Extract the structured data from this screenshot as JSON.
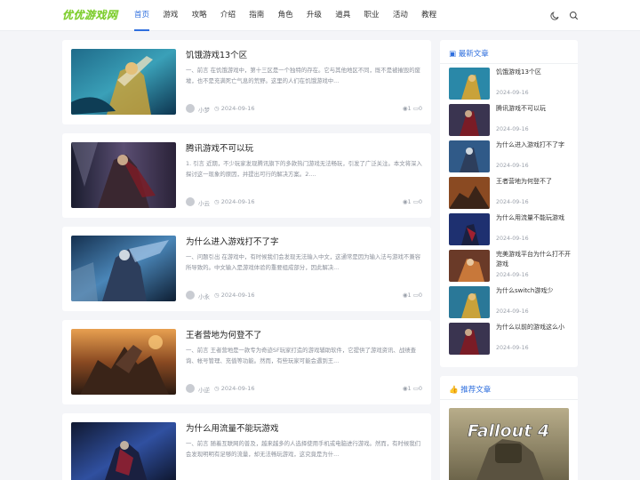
{
  "site": {
    "logo": "优优游戏网"
  },
  "nav": [
    "首页",
    "游戏",
    "攻略",
    "介绍",
    "指南",
    "角色",
    "升级",
    "道具",
    "职业",
    "活动",
    "教程"
  ],
  "header_icons": [
    "moon-icon",
    "search-icon"
  ],
  "posts": [
    {
      "title": "饥饿游戏13个区",
      "excerpt": "一、前言 在饥饿游戏中，第十三区是一个独特的存在。它与其他地区不同，既不是被摧毁的废墟，也不是充满死亡气息的荒野。这里的人们在饥饿游戏中...",
      "author": "小梦",
      "date": "2024-09-16",
      "views": "1",
      "comments": "0"
    },
    {
      "title": "腾讯游戏不可以玩",
      "excerpt": "1. 引言 近期，不少玩家发现腾讯旗下的多款热门游戏无法畅玩，引发了广泛关注。本文将深入探讨这一现象的原因，并提出可行的解决方案。2....",
      "author": "小云",
      "date": "2024-09-16",
      "views": "1",
      "comments": "0"
    },
    {
      "title": "为什么进入游戏打不了字",
      "excerpt": "一、问题引出 在游戏中，有时候我们会发现无法输入中文，这通常是因为输入法与游戏不兼容所导致的。中文输入是游戏体验的重要组成部分，因此解决...",
      "author": "小永",
      "date": "2024-09-16",
      "views": "1",
      "comments": "0"
    },
    {
      "title": "王者营地为何登不了",
      "excerpt": "一、前言 王者营地是一款专为奇迹SF玩家打造的游戏辅助软件，它提供了游戏资讯、战绩查询、帐号管理、充值等功能。然而，有些玩家可能会遇到王...",
      "author": "小逆",
      "date": "2024-09-16",
      "views": "1",
      "comments": "0"
    },
    {
      "title": "为什么用流量不能玩游戏",
      "excerpt": "一、前言 随着互联网的普及，越来越多的人选择使用手机或电脑进行游戏。然而，有时候我们会发现明明有足够的流量，却无法畅玩游戏，这究竟是为什...",
      "author": "",
      "date": "",
      "views": "",
      "comments": ""
    }
  ],
  "sidebar_latest": {
    "title": "最新文章",
    "items": [
      {
        "title": "饥饿游戏13个区",
        "date": "2024-09-16"
      },
      {
        "title": "腾讯游戏不可以玩",
        "date": "2024-09-16"
      },
      {
        "title": "为什么进入游戏打不了字",
        "date": "2024-09-16"
      },
      {
        "title": "王者营地为何登不了",
        "date": "2024-09-16"
      },
      {
        "title": "为什么用流量不能玩游戏",
        "date": "2024-09-16"
      },
      {
        "title": "完美游戏平台为什么打不开游戏",
        "date": "2024-09-16"
      },
      {
        "title": "为什么switch游戏少",
        "date": "2024-09-16"
      },
      {
        "title": "为什么以前的游戏这么小",
        "date": "2024-09-16"
      }
    ]
  },
  "sidebar_recommended": {
    "title": "推荐文章",
    "image_text": "Fallout 4"
  },
  "colors": {
    "accent": "#2f6fde",
    "logo": "#7ccc2c"
  }
}
